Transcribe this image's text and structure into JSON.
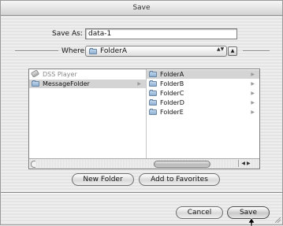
{
  "window": {
    "title": "Save"
  },
  "save_as": {
    "label": "Save As:",
    "value": "data-1"
  },
  "where": {
    "label": "Where:",
    "selected": "FolderA",
    "popup_arrows": "▲▼",
    "expand_icon": "triangle-up-icon"
  },
  "browser": {
    "column1": [
      {
        "label": "DSS Player",
        "icon": "disk-icon",
        "dimmed": true,
        "has_children": false
      },
      {
        "label": "MessageFolder",
        "icon": "folder-icon",
        "selected": true,
        "has_children": true
      }
    ],
    "column2": [
      {
        "label": "FolderA",
        "icon": "folder-icon",
        "selected": true,
        "has_children": true
      },
      {
        "label": "FolderB",
        "icon": "folder-icon",
        "has_children": true
      },
      {
        "label": "FolderC",
        "icon": "folder-icon",
        "has_children": true
      },
      {
        "label": "FolderD",
        "icon": "folder-icon",
        "has_children": true
      },
      {
        "label": "FolderE",
        "icon": "folder-icon",
        "has_children": true
      }
    ],
    "child_arrow": "▶",
    "scroll_arrows": "◀ ▶"
  },
  "buttons": {
    "new_folder": "New Folder",
    "add_to_favorites": "Add to Favorites",
    "cancel": "Cancel",
    "save": "Save"
  },
  "colors": {
    "selection": "#d4d4d4",
    "folder": "#8fb0d3"
  }
}
